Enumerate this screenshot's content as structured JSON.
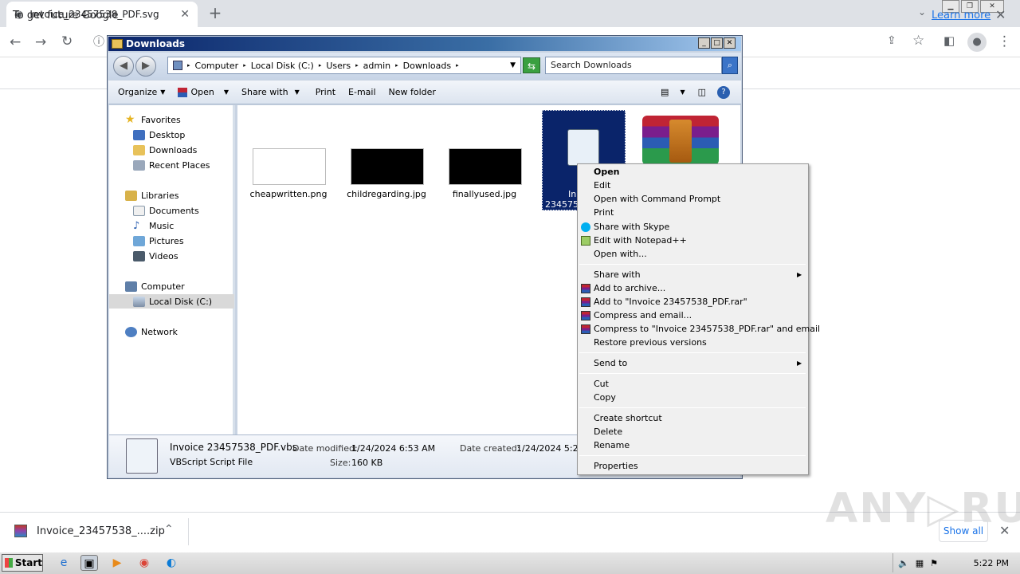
{
  "browser": {
    "tab_title": "Invoice_23457538_PDF.svg",
    "new_tab": "+",
    "info_text": "To get future Google",
    "learn_more": "Learn more"
  },
  "download_bar": {
    "file_name": "Invoice_23457538_....zip",
    "show_all": "Show all"
  },
  "watermark": "ANY▷RUN",
  "taskbar": {
    "start": "Start",
    "clock": "5:22 PM"
  },
  "explorer": {
    "title": "Downloads",
    "breadcrumb": [
      "Computer",
      "Local Disk (C:)",
      "Users",
      "admin",
      "Downloads"
    ],
    "search_placeholder": "Search Downloads",
    "toolbar": [
      "Organize",
      "Open",
      "Share with",
      "Print",
      "E-mail",
      "New folder"
    ],
    "nav": {
      "favorites": "Favorites",
      "desktop": "Desktop",
      "downloads": "Downloads",
      "recent": "Recent Places",
      "libraries": "Libraries",
      "documents": "Documents",
      "music": "Music",
      "pictures": "Pictures",
      "videos": "Videos",
      "computer": "Computer",
      "local_disk": "Local Disk (C:)",
      "network": "Network"
    },
    "files": [
      "cheapwritten.png",
      "childregarding.jpg",
      "finallyused.jpg"
    ],
    "selected_file_label_1": "In",
    "selected_file_label_2": "2345753",
    "details": {
      "name": "Invoice 23457538_PDF.vbs",
      "type": "VBScript Script File",
      "date_modified_label": "Date modified:",
      "date_modified": "1/24/2024 6:53 AM",
      "size_label": "Size:",
      "size": "160 KB",
      "date_created_label": "Date created:",
      "date_created": "1/24/2024 5:22"
    }
  },
  "context_menu": {
    "open": "Open",
    "edit": "Edit",
    "open_cmd": "Open with Command Prompt",
    "print": "Print",
    "share_skype": "Share with Skype",
    "edit_npp": "Edit with Notepad++",
    "open_with": "Open with...",
    "share_with": "Share with",
    "add_archive": "Add to archive...",
    "add_rar": "Add to \"Invoice 23457538_PDF.rar\"",
    "compress_email": "Compress and email...",
    "compress_rar_email": "Compress to \"Invoice 23457538_PDF.rar\" and email",
    "restore": "Restore previous versions",
    "send_to": "Send to",
    "cut": "Cut",
    "copy": "Copy",
    "create_shortcut": "Create shortcut",
    "delete": "Delete",
    "rename": "Rename",
    "properties": "Properties"
  }
}
